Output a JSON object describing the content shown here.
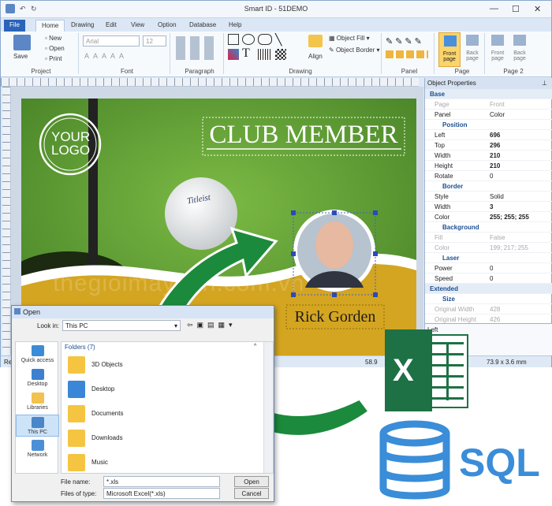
{
  "app": {
    "title": "Smart ID - 51DEMO"
  },
  "tabs": [
    "File",
    "Home",
    "Drawing",
    "Edit",
    "View",
    "Option",
    "Database",
    "Help"
  ],
  "ribbon": {
    "project": {
      "save": "Save",
      "new": "New",
      "open": "Open",
      "print": "Print",
      "label": "Project"
    },
    "font": {
      "family": "Arial",
      "size": "12",
      "label": "Font"
    },
    "paragraph": {
      "label": "Paragraph"
    },
    "drawing": {
      "label": "Drawing",
      "align": "Align",
      "object_fill": "Object Fill",
      "object_border": "Object Border"
    },
    "panel": {
      "label": "Panel"
    },
    "page": {
      "front": "Front page",
      "back": "Back page",
      "label": "Page"
    },
    "page2": {
      "front": "Front page",
      "back": "Back page",
      "label": "Page 2"
    }
  },
  "card": {
    "logo_line1": "YOUR",
    "logo_line2": "LOGO",
    "title": "CLUB MEMBER",
    "name": "Rick Gorden",
    "ball_brand": "Titleist"
  },
  "watermark": "thegioimaytinh.com.vn",
  "properties": {
    "title": "Object Properties",
    "rows": [
      {
        "k": "Base",
        "v": "",
        "t": "sec"
      },
      {
        "k": "Page",
        "v": "Front",
        "t": "dis"
      },
      {
        "k": "Panel",
        "v": "Color",
        "t": ""
      },
      {
        "k": "Position",
        "v": "",
        "t": "sub"
      },
      {
        "k": "Left",
        "v": "696",
        "t": "b"
      },
      {
        "k": "Top",
        "v": "296",
        "t": "b"
      },
      {
        "k": "Width",
        "v": "210",
        "t": "b"
      },
      {
        "k": "Height",
        "v": "210",
        "t": "b"
      },
      {
        "k": "Rotate",
        "v": "0",
        "t": ""
      },
      {
        "k": "Border",
        "v": "",
        "t": "sub"
      },
      {
        "k": "Style",
        "v": "Solid",
        "t": ""
      },
      {
        "k": "Width",
        "v": "3",
        "t": "b"
      },
      {
        "k": "Color",
        "v": "255; 255; 255",
        "t": "b"
      },
      {
        "k": "Background",
        "v": "",
        "t": "sub"
      },
      {
        "k": "Fill",
        "v": "False",
        "t": "dis"
      },
      {
        "k": "Color",
        "v": "199; 217; 255",
        "t": "dis"
      },
      {
        "k": "Laser",
        "v": "",
        "t": "sub"
      },
      {
        "k": "Power",
        "v": "0",
        "t": ""
      },
      {
        "k": "Speed",
        "v": "0",
        "t": ""
      },
      {
        "k": "Extended",
        "v": "",
        "t": "sec"
      },
      {
        "k": "Size",
        "v": "",
        "t": "sub"
      },
      {
        "k": "Original Width",
        "v": "428",
        "t": "dis"
      },
      {
        "k": "Original Height",
        "v": "426",
        "t": "dis"
      }
    ],
    "footer": "Left"
  },
  "status": {
    "left": "Re",
    "coord": "58.9",
    "size": "73.9 x 3.6 mm"
  },
  "dialog": {
    "title": "Open",
    "look_in_label": "Look in:",
    "look_in_value": "This PC",
    "folders_header": "Folders (7)",
    "nav": [
      "Quick access",
      "Desktop",
      "Libraries",
      "This PC",
      "Network"
    ],
    "folders": [
      "3D Objects",
      "Desktop",
      "Documents",
      "Downloads",
      "Music"
    ],
    "file_name_label": "File name:",
    "file_name_value": "*.xls",
    "file_type_label": "Files of type:",
    "file_type_value": "Microsoft Excel(*.xls)",
    "open_btn": "Open",
    "cancel_btn": "Cancel"
  },
  "sql": {
    "label": "SQL"
  },
  "excel": {
    "letter": "X"
  },
  "colors": {
    "accent": "#2b63b8",
    "excel": "#1e7145",
    "sql": "#3a8dd8",
    "arrow": "#1c8a3c",
    "grass": "#5d9a32",
    "gold": "#d4a520"
  },
  "icons": [
    "save-icon",
    "new-icon",
    "open-icon",
    "print-icon",
    "excel-icon",
    "database-icon",
    "folder-icon"
  ]
}
